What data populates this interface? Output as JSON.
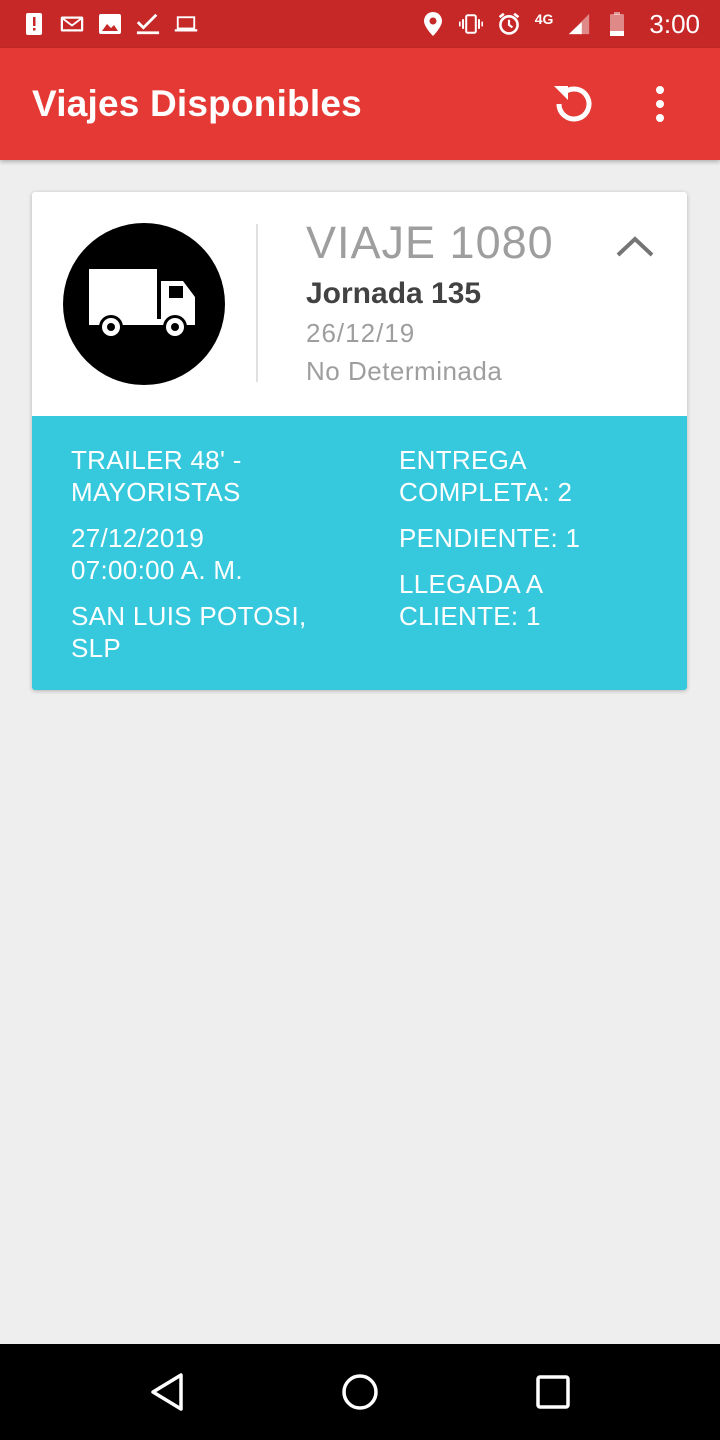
{
  "status_bar": {
    "time": "3:00",
    "network": "4G",
    "left_icons": [
      "alert-icon",
      "gmail-icon",
      "image-icon",
      "checkmark-icon",
      "laptop-icon"
    ],
    "right_icons": [
      "location-icon",
      "vibrate-icon",
      "alarm-icon",
      "signal-icon",
      "battery-icon"
    ]
  },
  "app_bar": {
    "title": "Viajes Disponibles",
    "actions": [
      "refresh-icon",
      "overflow-menu-icon"
    ]
  },
  "trips": [
    {
      "title": "VIAJE 1080",
      "jornada": "Jornada 135",
      "date": "26/12/19",
      "status": "No Determinada",
      "icon": "truck-icon",
      "details": {
        "trailer_line1": "TRAILER 48' -",
        "trailer_line2": "MAYORISTAS",
        "datetime_line1": "27/12/2019",
        "datetime_line2": "07:00:00 A. M.",
        "location_line1": "SAN LUIS POTOSI,",
        "location_line2": "SLP",
        "entrega_line1": "ENTREGA",
        "entrega_line2": "COMPLETA: 2",
        "pendiente": "PENDIENTE: 1",
        "llegada_line1": "LLEGADA A",
        "llegada_line2": "CLIENTE: 1"
      }
    }
  ],
  "colors": {
    "status_bar": "#c62828",
    "app_bar": "#e53935",
    "detail_panel": "#36c8dc",
    "background": "#eeeeee"
  },
  "nav_bar": [
    "back-icon",
    "home-icon",
    "recents-icon"
  ]
}
